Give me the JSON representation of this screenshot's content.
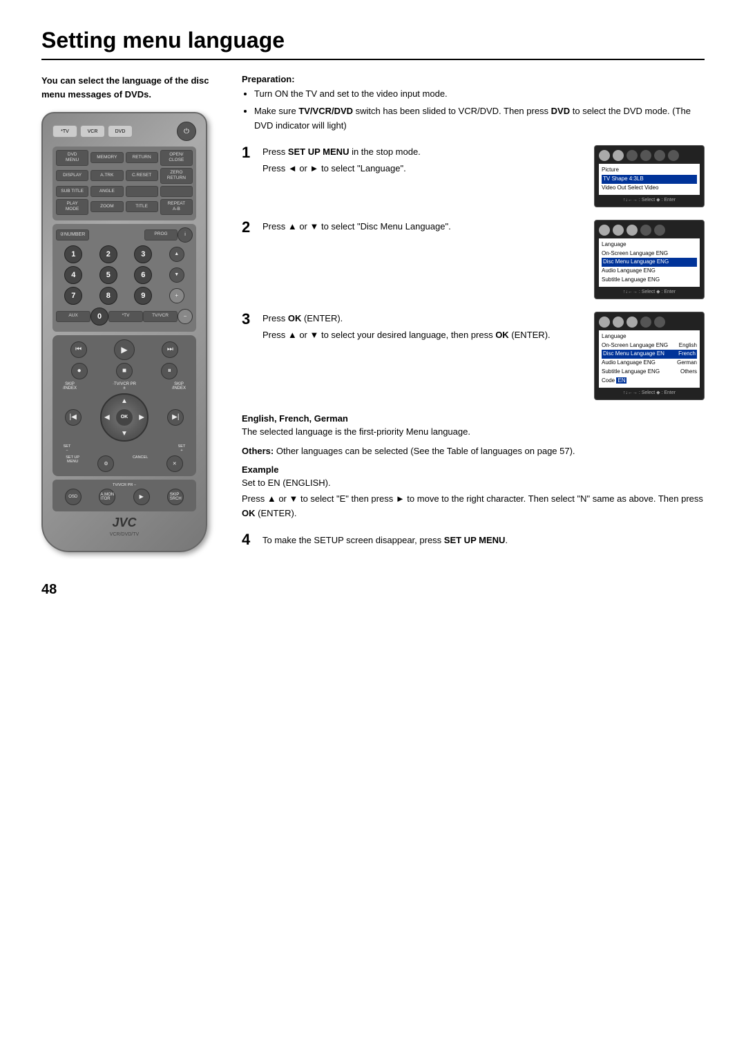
{
  "page": {
    "title": "Setting menu language",
    "number": "48"
  },
  "intro": {
    "text": "You can select the language of the disc menu messages of DVDs."
  },
  "preparation": {
    "header": "Preparation:",
    "steps": [
      "Turn ON the TV and set to the video input mode.",
      "Make sure TV/VCR/DVD switch has been slided to VCR/DVD. Then press DVD to select the DVD mode. (The DVD indicator will light)"
    ]
  },
  "steps": [
    {
      "number": "1",
      "main": "Press SET UP MENU in the stop mode.",
      "sub": "Press ◄ or ► to select \"Language\".",
      "screen": {
        "menu_items": [
          {
            "label": "Picture",
            "value": ""
          },
          {
            "label": "TV Shape 4:3LB",
            "value": "",
            "highlight": true
          },
          {
            "label": "Video Out Select Video",
            "value": ""
          }
        ],
        "nav": "↑↓←→ : Select ◆ : Enter"
      }
    },
    {
      "number": "2",
      "main": "Press ▲ or ▼ to select \"Disc Menu Language\".",
      "screen": {
        "menu_items": [
          {
            "label": "Language",
            "value": ""
          },
          {
            "label": "On-Screen Language ENG",
            "value": ""
          },
          {
            "label": "Disc Menu Language ENG",
            "value": "",
            "highlight": true
          },
          {
            "label": "Audio Language ENG",
            "value": ""
          },
          {
            "label": "Subtitle Language ENG",
            "value": ""
          }
        ],
        "nav": "↑↓←→ : Select ◆ : Enter"
      }
    },
    {
      "number": "3",
      "main": "Press OK (ENTER).",
      "sub": "Press ▲ or ▼ to select your desired language, then press OK (ENTER).",
      "screen": {
        "menu_items": [
          {
            "label": "Language",
            "value": ""
          },
          {
            "label": "On-Screen Language ENG",
            "value": "English"
          },
          {
            "label": "Disc Menu Language EN",
            "value": "French",
            "highlight": true
          },
          {
            "label": "Audio Language ENG",
            "value": "German"
          },
          {
            "label": "Subtitle Language ENG",
            "value": "Others"
          },
          {
            "label": "Code EN",
            "value": ""
          }
        ],
        "nav": "↑↓←→ : Select ◆ : Enter"
      }
    }
  ],
  "english_french_german": {
    "header": "English, French, German",
    "text": "The selected language is the first-priority Menu language."
  },
  "others": {
    "label": "Others:",
    "text": "Other languages can be selected (See the Table of languages on page 57)."
  },
  "example": {
    "label": "Example",
    "text1": "Set to EN (ENGLISH).",
    "text2": "Press ▲ or ▼ to select \"E\" then press ► to move to the right character. Then select \"N\" same as above. Then press OK (ENTER)."
  },
  "step4": {
    "number": "4",
    "text": "To make the SETUP screen disappear, press SET UP MENU."
  },
  "remote": {
    "label": "VCR/DVD/TV"
  }
}
